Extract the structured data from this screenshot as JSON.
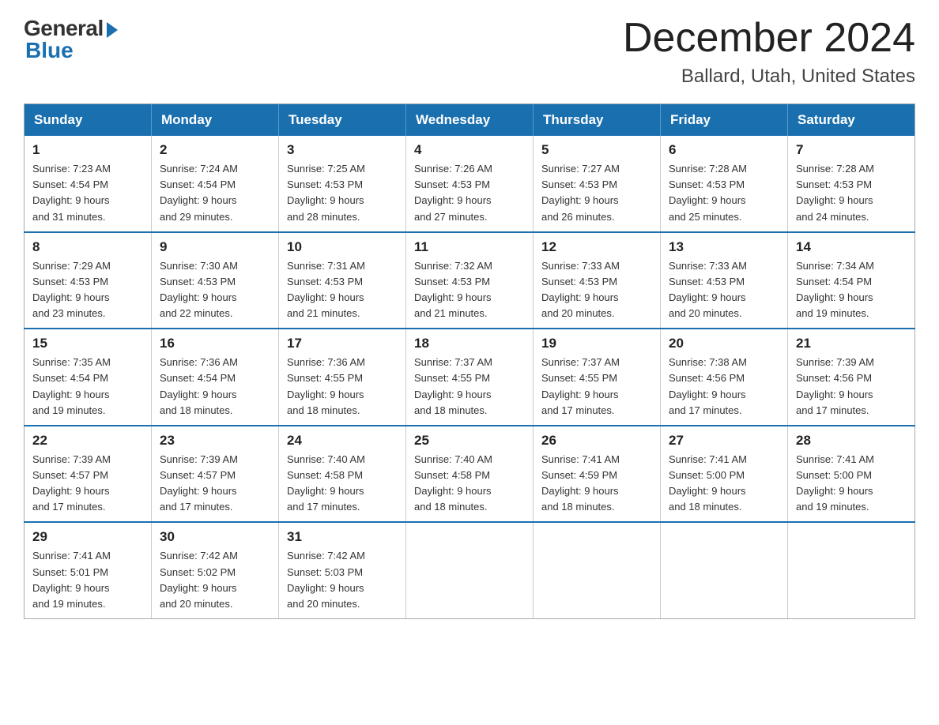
{
  "logo": {
    "general": "General",
    "blue": "Blue"
  },
  "header": {
    "month": "December 2024",
    "location": "Ballard, Utah, United States"
  },
  "weekdays": [
    "Sunday",
    "Monday",
    "Tuesday",
    "Wednesday",
    "Thursday",
    "Friday",
    "Saturday"
  ],
  "weeks": [
    [
      {
        "day": "1",
        "info": "Sunrise: 7:23 AM\nSunset: 4:54 PM\nDaylight: 9 hours\nand 31 minutes."
      },
      {
        "day": "2",
        "info": "Sunrise: 7:24 AM\nSunset: 4:54 PM\nDaylight: 9 hours\nand 29 minutes."
      },
      {
        "day": "3",
        "info": "Sunrise: 7:25 AM\nSunset: 4:53 PM\nDaylight: 9 hours\nand 28 minutes."
      },
      {
        "day": "4",
        "info": "Sunrise: 7:26 AM\nSunset: 4:53 PM\nDaylight: 9 hours\nand 27 minutes."
      },
      {
        "day": "5",
        "info": "Sunrise: 7:27 AM\nSunset: 4:53 PM\nDaylight: 9 hours\nand 26 minutes."
      },
      {
        "day": "6",
        "info": "Sunrise: 7:28 AM\nSunset: 4:53 PM\nDaylight: 9 hours\nand 25 minutes."
      },
      {
        "day": "7",
        "info": "Sunrise: 7:28 AM\nSunset: 4:53 PM\nDaylight: 9 hours\nand 24 minutes."
      }
    ],
    [
      {
        "day": "8",
        "info": "Sunrise: 7:29 AM\nSunset: 4:53 PM\nDaylight: 9 hours\nand 23 minutes."
      },
      {
        "day": "9",
        "info": "Sunrise: 7:30 AM\nSunset: 4:53 PM\nDaylight: 9 hours\nand 22 minutes."
      },
      {
        "day": "10",
        "info": "Sunrise: 7:31 AM\nSunset: 4:53 PM\nDaylight: 9 hours\nand 21 minutes."
      },
      {
        "day": "11",
        "info": "Sunrise: 7:32 AM\nSunset: 4:53 PM\nDaylight: 9 hours\nand 21 minutes."
      },
      {
        "day": "12",
        "info": "Sunrise: 7:33 AM\nSunset: 4:53 PM\nDaylight: 9 hours\nand 20 minutes."
      },
      {
        "day": "13",
        "info": "Sunrise: 7:33 AM\nSunset: 4:53 PM\nDaylight: 9 hours\nand 20 minutes."
      },
      {
        "day": "14",
        "info": "Sunrise: 7:34 AM\nSunset: 4:54 PM\nDaylight: 9 hours\nand 19 minutes."
      }
    ],
    [
      {
        "day": "15",
        "info": "Sunrise: 7:35 AM\nSunset: 4:54 PM\nDaylight: 9 hours\nand 19 minutes."
      },
      {
        "day": "16",
        "info": "Sunrise: 7:36 AM\nSunset: 4:54 PM\nDaylight: 9 hours\nand 18 minutes."
      },
      {
        "day": "17",
        "info": "Sunrise: 7:36 AM\nSunset: 4:55 PM\nDaylight: 9 hours\nand 18 minutes."
      },
      {
        "day": "18",
        "info": "Sunrise: 7:37 AM\nSunset: 4:55 PM\nDaylight: 9 hours\nand 18 minutes."
      },
      {
        "day": "19",
        "info": "Sunrise: 7:37 AM\nSunset: 4:55 PM\nDaylight: 9 hours\nand 17 minutes."
      },
      {
        "day": "20",
        "info": "Sunrise: 7:38 AM\nSunset: 4:56 PM\nDaylight: 9 hours\nand 17 minutes."
      },
      {
        "day": "21",
        "info": "Sunrise: 7:39 AM\nSunset: 4:56 PM\nDaylight: 9 hours\nand 17 minutes."
      }
    ],
    [
      {
        "day": "22",
        "info": "Sunrise: 7:39 AM\nSunset: 4:57 PM\nDaylight: 9 hours\nand 17 minutes."
      },
      {
        "day": "23",
        "info": "Sunrise: 7:39 AM\nSunset: 4:57 PM\nDaylight: 9 hours\nand 17 minutes."
      },
      {
        "day": "24",
        "info": "Sunrise: 7:40 AM\nSunset: 4:58 PM\nDaylight: 9 hours\nand 17 minutes."
      },
      {
        "day": "25",
        "info": "Sunrise: 7:40 AM\nSunset: 4:58 PM\nDaylight: 9 hours\nand 18 minutes."
      },
      {
        "day": "26",
        "info": "Sunrise: 7:41 AM\nSunset: 4:59 PM\nDaylight: 9 hours\nand 18 minutes."
      },
      {
        "day": "27",
        "info": "Sunrise: 7:41 AM\nSunset: 5:00 PM\nDaylight: 9 hours\nand 18 minutes."
      },
      {
        "day": "28",
        "info": "Sunrise: 7:41 AM\nSunset: 5:00 PM\nDaylight: 9 hours\nand 19 minutes."
      }
    ],
    [
      {
        "day": "29",
        "info": "Sunrise: 7:41 AM\nSunset: 5:01 PM\nDaylight: 9 hours\nand 19 minutes."
      },
      {
        "day": "30",
        "info": "Sunrise: 7:42 AM\nSunset: 5:02 PM\nDaylight: 9 hours\nand 20 minutes."
      },
      {
        "day": "31",
        "info": "Sunrise: 7:42 AM\nSunset: 5:03 PM\nDaylight: 9 hours\nand 20 minutes."
      },
      null,
      null,
      null,
      null
    ]
  ]
}
